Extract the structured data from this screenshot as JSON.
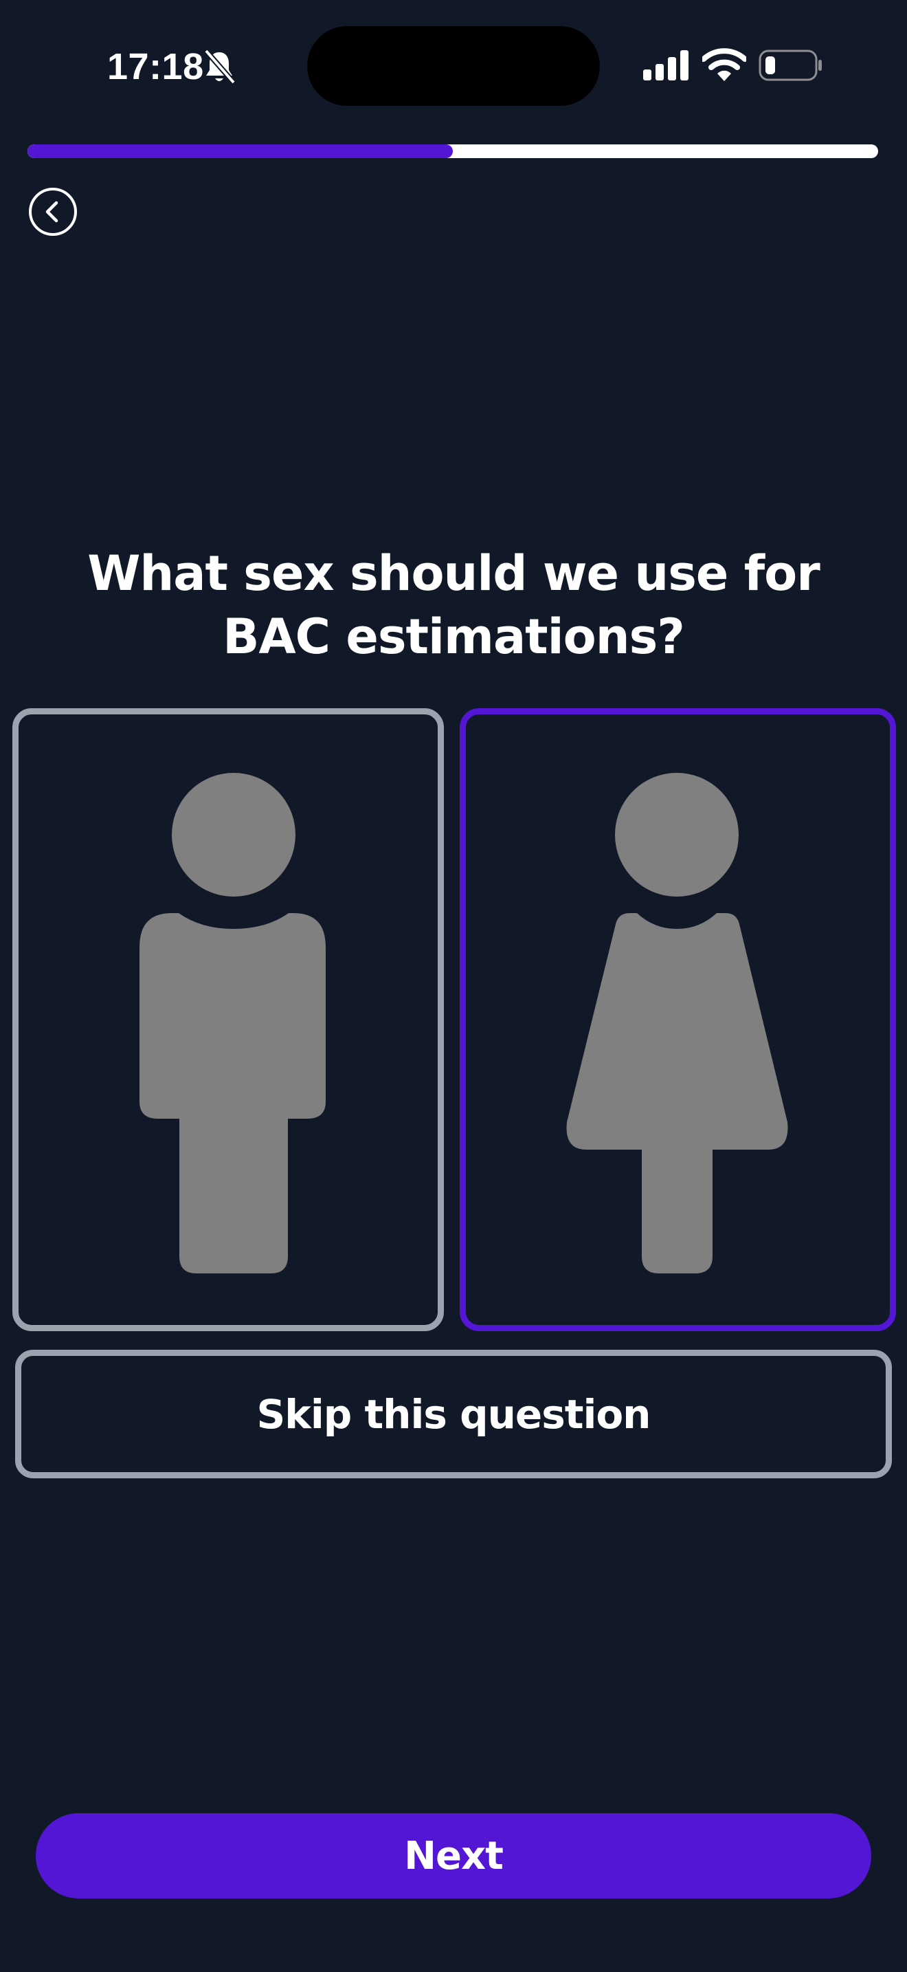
{
  "status_bar": {
    "time": "17:18",
    "icons": [
      "bell-slash-icon",
      "signal-icon",
      "wifi-icon",
      "battery-low-icon"
    ]
  },
  "progress": {
    "fraction": 0.5
  },
  "navigation": {
    "back_icon": "chevron-left-circle-icon"
  },
  "question": {
    "title": "What sex should we use for BAC estimations?"
  },
  "options": [
    {
      "id": "male",
      "icon": "male-figure-icon",
      "selected": false
    },
    {
      "id": "female",
      "icon": "female-figure-icon",
      "selected": true
    }
  ],
  "skip": {
    "label": "Skip this question"
  },
  "next": {
    "label": "Next"
  },
  "colors": {
    "background": "#111827",
    "accent": "#5216d4",
    "unselected_border": "#9ca3af",
    "figure": "#808080",
    "text": "#ffffff"
  }
}
